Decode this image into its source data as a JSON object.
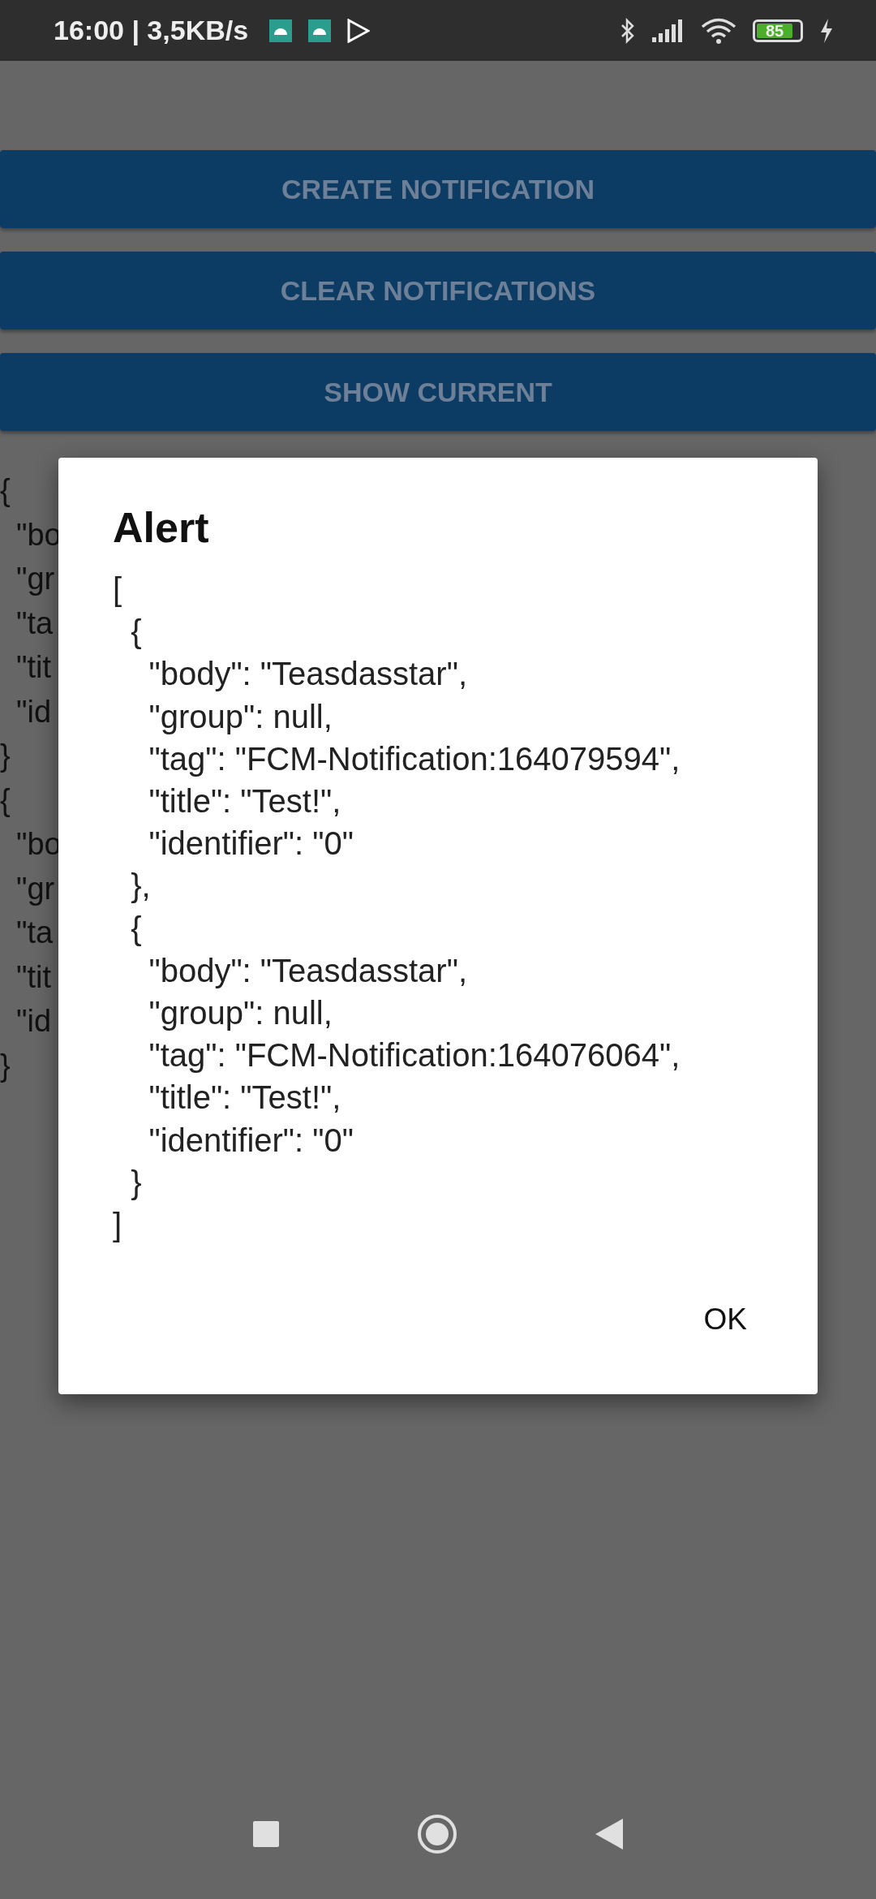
{
  "status_bar": {
    "time": "16:00 | 3,5KB/s",
    "battery": "85"
  },
  "buttons": [
    {
      "label": "CREATE NOTIFICATION"
    },
    {
      "label": "CLEAR NOTIFICATIONS"
    },
    {
      "label": "SHOW CURRENT"
    }
  ],
  "background_output": [
    "{",
    "\"bo",
    "\"gr",
    "\"ta",
    "\"tit",
    "\"id",
    "}",
    "{",
    "\"bo",
    "\"gr",
    "\"ta",
    "\"tit",
    "\"id",
    "}"
  ],
  "dialog": {
    "title": "Alert",
    "message": "[\n  {\n    \"body\": \"Teasdasstar\",\n    \"group\": null,\n    \"tag\": \"FCM-Notification:164079594\",\n    \"title\": \"Test!\",\n    \"identifier\": \"0\"\n  },\n  {\n    \"body\": \"Teasdasstar\",\n    \"group\": null,\n    \"tag\": \"FCM-Notification:164076064\",\n    \"title\": \"Test!\",\n    \"identifier\": \"0\"\n  }\n]",
    "button": "OK"
  }
}
